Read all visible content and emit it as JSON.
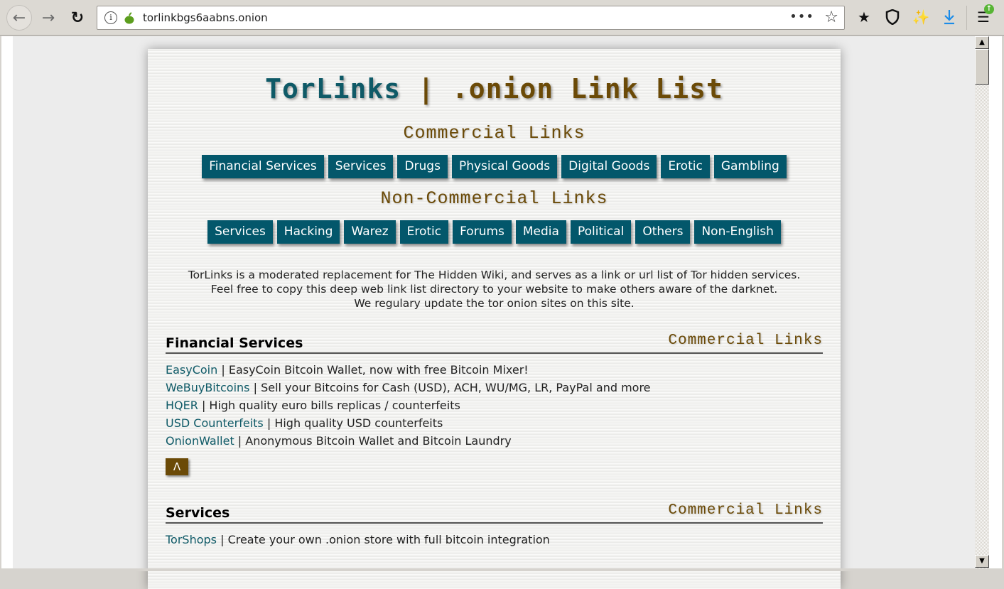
{
  "browser": {
    "url": "torlinkbgs6aabns.onion",
    "icons": {
      "back": "back-arrow-icon",
      "forward": "forward-arrow-icon",
      "reload": "reload-icon",
      "info": "info-icon",
      "onion": "tor-onion-icon",
      "more": "more-dots-icon",
      "bookmark": "star-icon",
      "bookmarks_menu": "bookmarks-tray-icon",
      "shield": "shield-icon",
      "broom": "new-identity-icon",
      "download": "download-icon",
      "menu": "hamburger-menu-icon",
      "update_badge": "update-arrow-icon"
    },
    "update_badge_color": "#57b534",
    "download_color": "#1b8ce8"
  },
  "site": {
    "title_part1": "TorLinks",
    "title_sep": " | ",
    "title_part2": ".onion Link List",
    "colors": {
      "teal": "#03576b",
      "brown": "#6b4a07"
    },
    "commercial_heading": "Commercial Links",
    "commercial_buttons": [
      "Financial Services",
      "Services",
      "Drugs",
      "Physical Goods",
      "Digital Goods",
      "Erotic",
      "Gambling"
    ],
    "noncommercial_heading": "Non-Commercial Links",
    "noncommercial_buttons": [
      "Services",
      "Hacking",
      "Warez",
      "Erotic",
      "Forums",
      "Media",
      "Political",
      "Others",
      "Non-English"
    ],
    "intro": [
      "TorLinks is a moderated replacement for The Hidden Wiki, and serves as a link or url list of Tor hidden services.",
      "Feel free to copy this deep web link list directory to your website to make others aware of the darknet.",
      "We regulary update the tor onion sites on this site."
    ]
  },
  "sections": [
    {
      "title": "Financial Services",
      "tag": "Commercial Links",
      "entries": [
        {
          "name": "EasyCoin",
          "desc": "EasyCoin Bitcoin Wallet, now with free Bitcoin Mixer!"
        },
        {
          "name": "WeBuyBitcoins",
          "desc": "Sell your Bitcoins for Cash (USD), ACH, WU/MG, LR, PayPal and more"
        },
        {
          "name": "HQER",
          "desc": "High quality euro bills replicas / counterfeits"
        },
        {
          "name": "USD Counterfeits",
          "desc": "High quality USD counterfeits"
        },
        {
          "name": "OnionWallet",
          "desc": "Anonymous Bitcoin Wallet and Bitcoin Laundry"
        }
      ],
      "back_to_top": "Λ"
    },
    {
      "title": "Services",
      "tag": "Commercial Links",
      "entries": [
        {
          "name": "TorShops",
          "desc": "Create your own .onion store with full bitcoin integration"
        }
      ]
    }
  ],
  "separator": " | "
}
